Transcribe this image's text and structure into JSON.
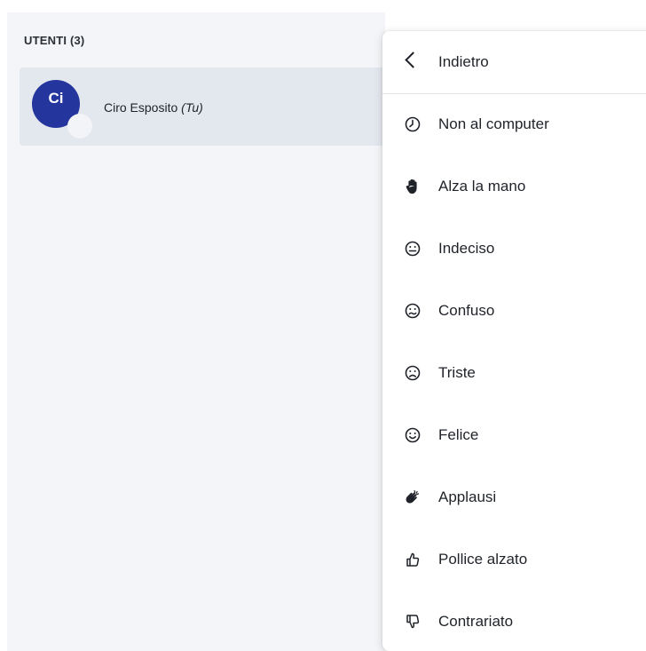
{
  "users_panel": {
    "header": "UTENTI (3)",
    "current_user": {
      "initials": "Ci",
      "name": "Ciro Esposito",
      "tag": "(Tu)",
      "avatar_color": "#24359e"
    }
  },
  "status_menu": {
    "back_label": "Indietro",
    "items": [
      {
        "label": "Non al computer",
        "icon": "clock-icon"
      },
      {
        "label": "Alza la mano",
        "icon": "raised-hand-icon"
      },
      {
        "label": "Indeciso",
        "icon": "neutral-face-icon"
      },
      {
        "label": "Confuso",
        "icon": "confused-face-icon"
      },
      {
        "label": "Triste",
        "icon": "sad-face-icon"
      },
      {
        "label": "Felice",
        "icon": "happy-face-icon"
      },
      {
        "label": "Applausi",
        "icon": "applause-icon"
      },
      {
        "label": "Pollice alzato",
        "icon": "thumbs-up-icon"
      },
      {
        "label": "Contrariato",
        "icon": "thumbs-down-icon"
      }
    ]
  }
}
